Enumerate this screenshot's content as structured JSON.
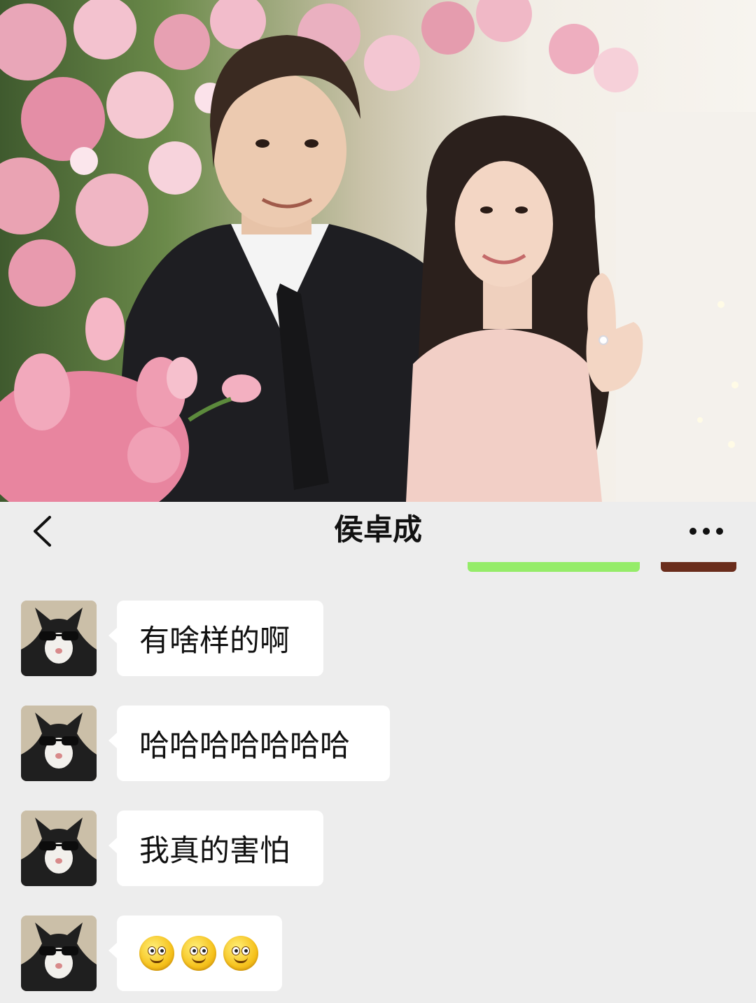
{
  "chat": {
    "title": "侯卓成",
    "back_icon": "chevron-left-icon",
    "more_icon": "ellipsis-icon"
  },
  "messages": [
    {
      "sender": "contact",
      "type": "text",
      "text": "有啥样的啊"
    },
    {
      "sender": "contact",
      "type": "text",
      "text": "哈哈哈哈哈哈哈"
    },
    {
      "sender": "contact",
      "type": "text",
      "text": "我真的害怕"
    },
    {
      "sender": "contact",
      "type": "emoji",
      "emoji_names": [
        "smile-emoji",
        "smile-emoji",
        "smile-emoji"
      ]
    }
  ],
  "colors": {
    "chat_background": "#ededed",
    "bubble_incoming": "#ffffff",
    "bubble_outgoing": "#95ec69"
  }
}
